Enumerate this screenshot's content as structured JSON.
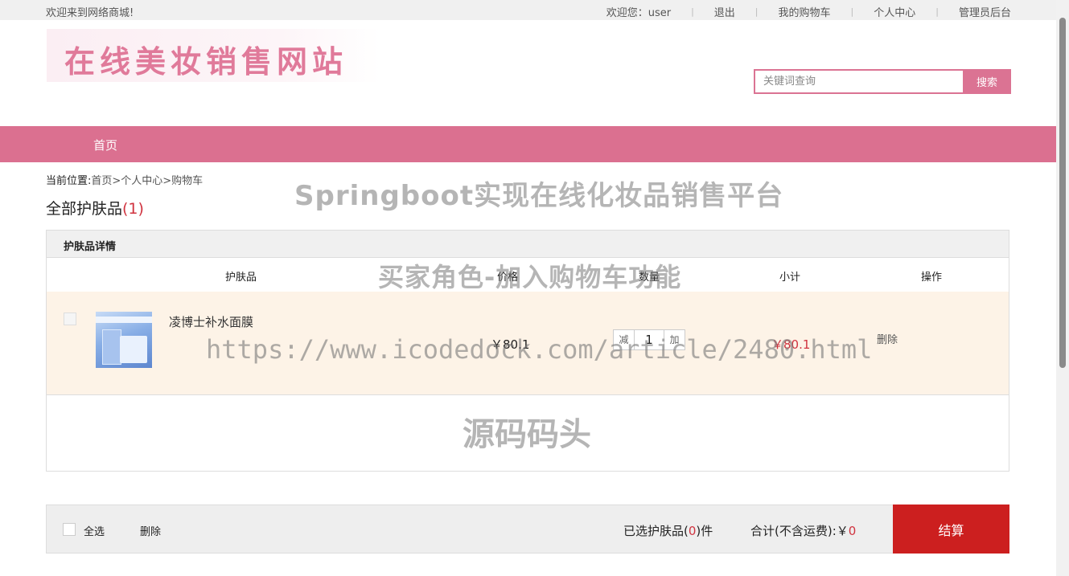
{
  "topbar": {
    "welcome": "欢迎来到网络商城!",
    "greeting": "欢迎您：user",
    "logout": "退出",
    "cart": "我的购物车",
    "profile": "个人中心",
    "admin": "管理员后台"
  },
  "header": {
    "logo_text": "在线美妆销售网站",
    "search_placeholder": "关键词查询",
    "search_button": "搜索"
  },
  "nav": {
    "home": "首页"
  },
  "breadcrumb": {
    "label": "当前位置:",
    "path": "首页>个人中心>购物车"
  },
  "page_title": {
    "text": "全部护肤品",
    "count": "(1)"
  },
  "table": {
    "section_title": "护肤品详情",
    "columns": [
      "护肤品",
      "价格",
      "数量",
      "小计",
      "操作"
    ],
    "rows": [
      {
        "name": "凌博士补水面膜",
        "price": "￥80.1",
        "qty_minus": "减",
        "quantity": "1",
        "qty_plus": "加",
        "subtotal": "￥80.1",
        "action": "删除"
      }
    ]
  },
  "footer": {
    "select_all": "全选",
    "delete": "删除",
    "selected_prefix": "已选护肤品(",
    "selected_count": "0",
    "selected_suffix": ")件",
    "total_label": "合计(不含运费):￥",
    "total_value": "0",
    "checkout": "结算"
  },
  "watermarks": {
    "line1": "Springboot实现在线化妆品销售平台",
    "line2": "买家角色-加入购物车功能",
    "line3": "https://www.icodedock.com/article/2480.html",
    "line4": "源码码头"
  },
  "colors": {
    "nav_pink": "#db7090",
    "accent_red": "#d0333f",
    "checkout_red": "#cc1f1f",
    "row_bg": "#fdf3e7"
  }
}
